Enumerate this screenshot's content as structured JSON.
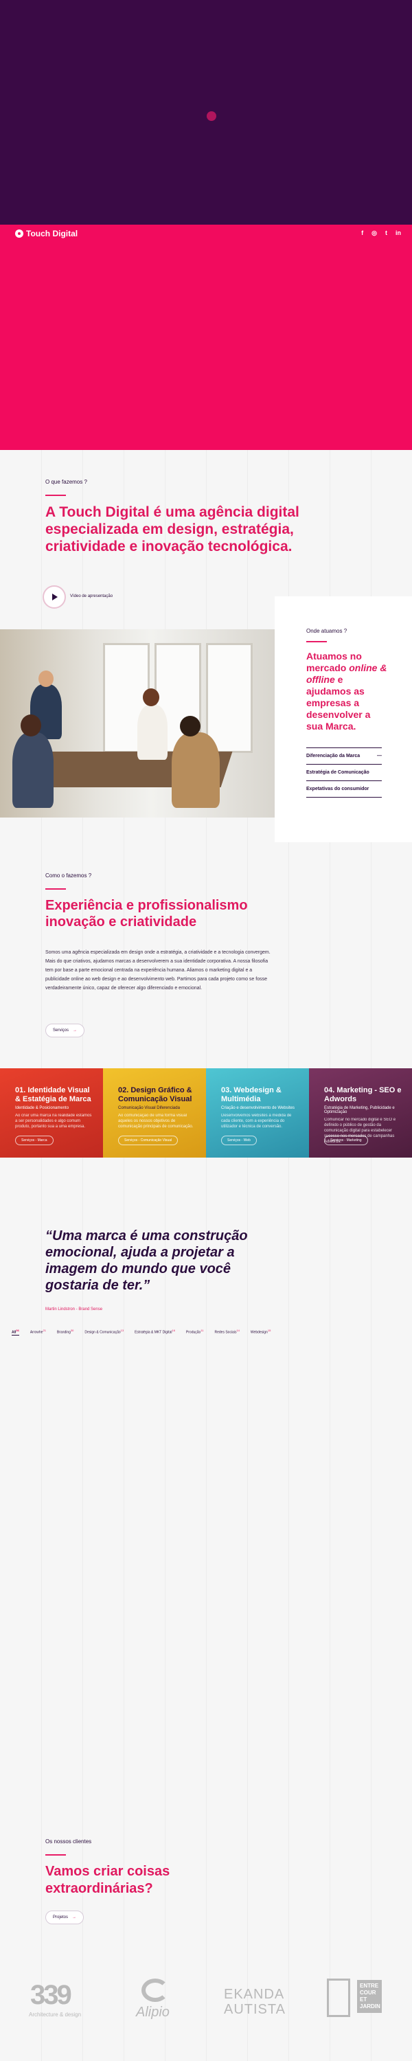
{
  "brand": {
    "name": "Touch Digital"
  },
  "social": [
    "f",
    "◎",
    "t",
    "in"
  ],
  "intro": {
    "eyebrow": "O que fazemos ?",
    "title": "A Touch Digital é uma agência digital especializada em design, estratégia, criatividade e inovação tecnológica.",
    "video_label": "Vídeo de apresentação"
  },
  "where": {
    "eyebrow": "Onde atuamos ?",
    "title_1": "Atuamos no mercado ",
    "title_em": "online & offline",
    "title_2": " e ajudamos as empresas a desenvolver a sua Marca.",
    "items": [
      "Diferenciação da Marca",
      "Estratégia de Comunicação",
      "Expetativas do consumidor"
    ]
  },
  "how": {
    "eyebrow": "Como o fazemos ?",
    "title": "Experiência e profissionalismo inovação e criatividade",
    "text": "Somos uma agência especializada em design onde a estratégia, a criatividade e a tecnologia convergem. Mais do que criativos, ajudamos marcas a desenvolverem a sua identidade corporativa. A nossa filosofia tem por base a parte emocional centrada na experiência humana. Aliamos o marketing digital e a publicidade online ao web design e ao desenvolvimento web. Partimos para cada projeto como se fosse verdadeiramente único, capaz de oferecer algo diferenciado e emocional.",
    "button": "Serviços"
  },
  "services": [
    {
      "title": "01. Identidade Visual & Estatégia de Marca",
      "sub": "Identidade & Posicionamento",
      "desc": "Ao criar uma marca na realidade estamos a ser personalidades e algo comum produto, portanto sua a uma empresa.",
      "button": "Serviços - Marca",
      "color": "#e03d2f"
    },
    {
      "title": "02. Design Gráfico & Comunicação Visual",
      "sub": "Comunicação Visual Diferenciada",
      "desc": "Ao comunicação de uma forma visual aqueles os nossos objetivos de comunicação principais de comunicação.",
      "button": "Serviços - Comunicação Visual",
      "color": "#e9b21f"
    },
    {
      "title": "03. Webdesign & Multimédia",
      "sub": "Criação e desenvolvimento de Websites",
      "desc": "Desenvolvemos websites à medida de cada cliente, com a experiência do utilizador e técnica de conversão.",
      "button": "Serviços - Web",
      "color": "#3cb6c6"
    },
    {
      "title": "04. Marketing - SEO e Adwords",
      "sub": "Estratégia de Marketing, Publicidade e Optimização",
      "desc": "Comunicar no mercado digital é SEO e definido o público de gestão da comunicação digital para estabelecer sucesso nos mercados de campanhas Adwords.",
      "button": "Serviços - Marketing",
      "color": "#6a2b52"
    }
  ],
  "quote": {
    "text": "“Uma marca é uma construção emocional, ajuda a projetar a imagem do mundo que você gostaria de ter.”",
    "author": "Martin Lindstron - Brand Sense"
  },
  "filters": [
    {
      "label": "All",
      "count": "56"
    },
    {
      "label": "Arrowhe",
      "count": "21"
    },
    {
      "label": "Branding",
      "count": "30"
    },
    {
      "label": "Design & Comunicação",
      "count": "13"
    },
    {
      "label": "Estratégia & MKT Digital",
      "count": "16"
    },
    {
      "label": "Produção",
      "count": "11"
    },
    {
      "label": "Redes Sociais",
      "count": "14"
    },
    {
      "label": "Webdesign",
      "count": "15"
    }
  ],
  "clients": {
    "eyebrow": "Os nossos clientes",
    "title": "Vamos criar coisas extraordinárias?",
    "button": "Projetos"
  },
  "logos": {
    "l339": "339",
    "l339_sub": "Architecture & design",
    "alipio": "Alipio",
    "ekanda_1": "EKANDA",
    "ekanda_2": "AUTISTA",
    "ecj": "ENTRE COUR ET JARDIN"
  },
  "colors": {
    "dark": "#3a0a45",
    "pink": "#f20b5e",
    "accent": "#e0195f"
  }
}
